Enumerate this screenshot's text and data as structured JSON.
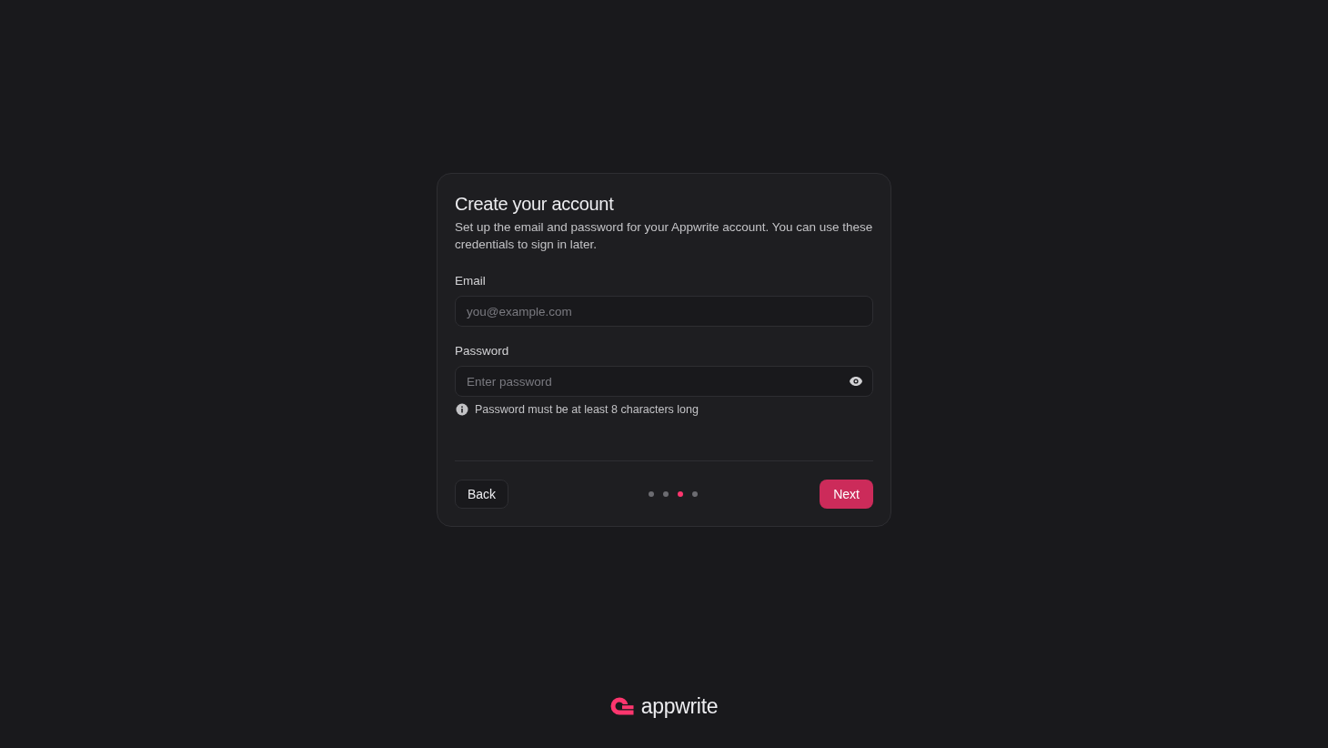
{
  "card": {
    "title": "Create your account",
    "description": "Set up the email and password for your Appwrite account. You can use these credentials to sign in later.",
    "fields": [
      {
        "kind": "email",
        "label": "Email",
        "placeholder": "you@example.com"
      },
      {
        "kind": "password",
        "label": "Password",
        "placeholder": "Enter password",
        "hint": "Password must be at least 8 characters long"
      }
    ],
    "back_button": "Back",
    "next_button": "Next",
    "steps": [
      {
        "selected": false
      },
      {
        "selected": false
      },
      {
        "selected": true
      },
      {
        "selected": false
      }
    ]
  },
  "logo": {
    "text": "appwrite"
  }
}
